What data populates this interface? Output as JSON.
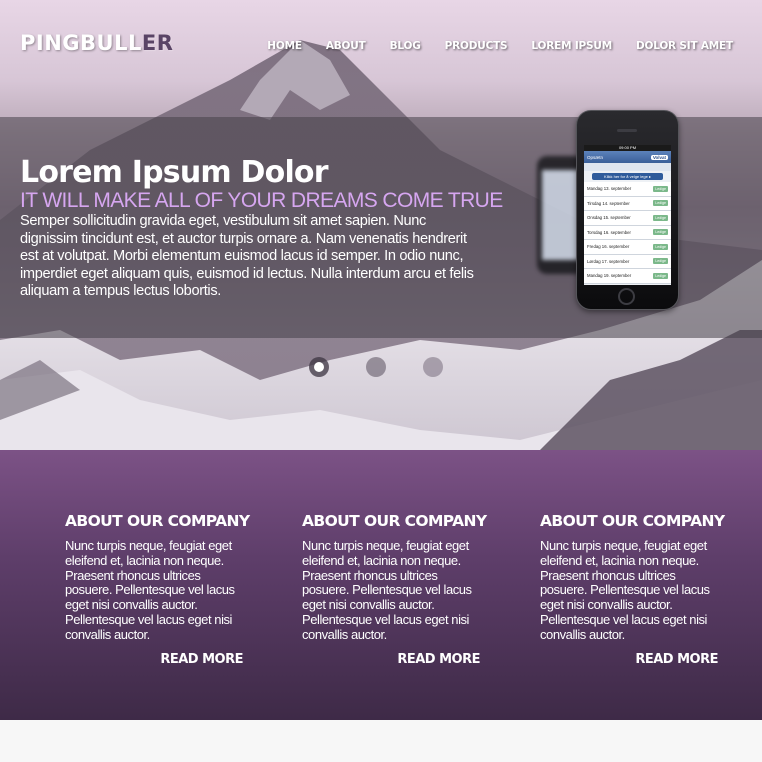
{
  "site": {
    "logo_main": "PINGBULL",
    "logo_accent": "ER"
  },
  "nav": {
    "items": [
      "HOME",
      "ABOUT",
      "BLOG",
      "PRODUCTS",
      "LOREM IPSUM",
      "DOLOR SIT AMET"
    ]
  },
  "hero": {
    "title": "Lorem Ipsum Dolor",
    "subtitle": "IT WILL MAKE ALL OF YOUR DREAMS COME TRUE",
    "body": "Semper sollicitudin gravida eget, vestibulum sit amet sapien. Nunc dignissim tincidunt est, et auctor turpis ornare a. Nam venenatis hendrerit est at volutpat. Morbi elementum euismod lacus id semper. In odio nunc, imperdiet eget aliquam quis, euismod id lectus. Nulla interdum arcu et felis aliquam a tempus lectus lobortis.",
    "slider": {
      "count": 3,
      "active_index": 0
    },
    "phone_screen": {
      "status": "09:00 PM",
      "left_button": "Opsætn",
      "brand": "Volvat",
      "cta": "Klikk her for å velge lege ▸",
      "rows": [
        {
          "date": "Mandag 13. september",
          "badge": "Ledige"
        },
        {
          "date": "Tirsdag 14. september",
          "badge": "Ledige"
        },
        {
          "date": "Onsdag 15. september",
          "badge": "Ledige"
        },
        {
          "date": "Torsdag 16. september",
          "badge": "Ledige"
        },
        {
          "date": "Fredag 16. september",
          "badge": "Ledige"
        },
        {
          "date": "Lørdag 17. september",
          "badge": "Ledige"
        },
        {
          "date": "Mandag 19. september",
          "badge": "Ledige"
        }
      ]
    }
  },
  "about": {
    "columns": [
      {
        "title": "ABOUT OUR COMPANY",
        "text": "Nunc turpis neque, feugiat eget eleifend et, lacinia non neque. Praesent rhoncus ultrices posuere. Pellentesque vel lacus eget nisi convallis auctor. Pellentesque vel lacus eget nisi convallis auctor.",
        "link": "READ MORE"
      },
      {
        "title": "ABOUT OUR COMPANY",
        "text": "Nunc turpis neque, feugiat eget eleifend et, lacinia non neque. Praesent rhoncus ultrices posuere. Pellentesque vel lacus eget nisi convallis auctor. Pellentesque vel lacus eget nisi convallis auctor.",
        "link": "READ MORE"
      },
      {
        "title": "ABOUT OUR COMPANY",
        "text": "Nunc turpis neque, feugiat eget eleifend et, lacinia non neque. Praesent rhoncus ultrices posuere. Pellentesque vel lacus eget nisi convallis auctor. Pellentesque vel lacus eget nisi convallis auctor.",
        "link": "READ MORE"
      }
    ]
  },
  "colors": {
    "accent_purple": "#d6a6f0",
    "logo_accent": "#5a4466",
    "about_top": "#7c5286",
    "about_bottom": "#3e2a47"
  }
}
